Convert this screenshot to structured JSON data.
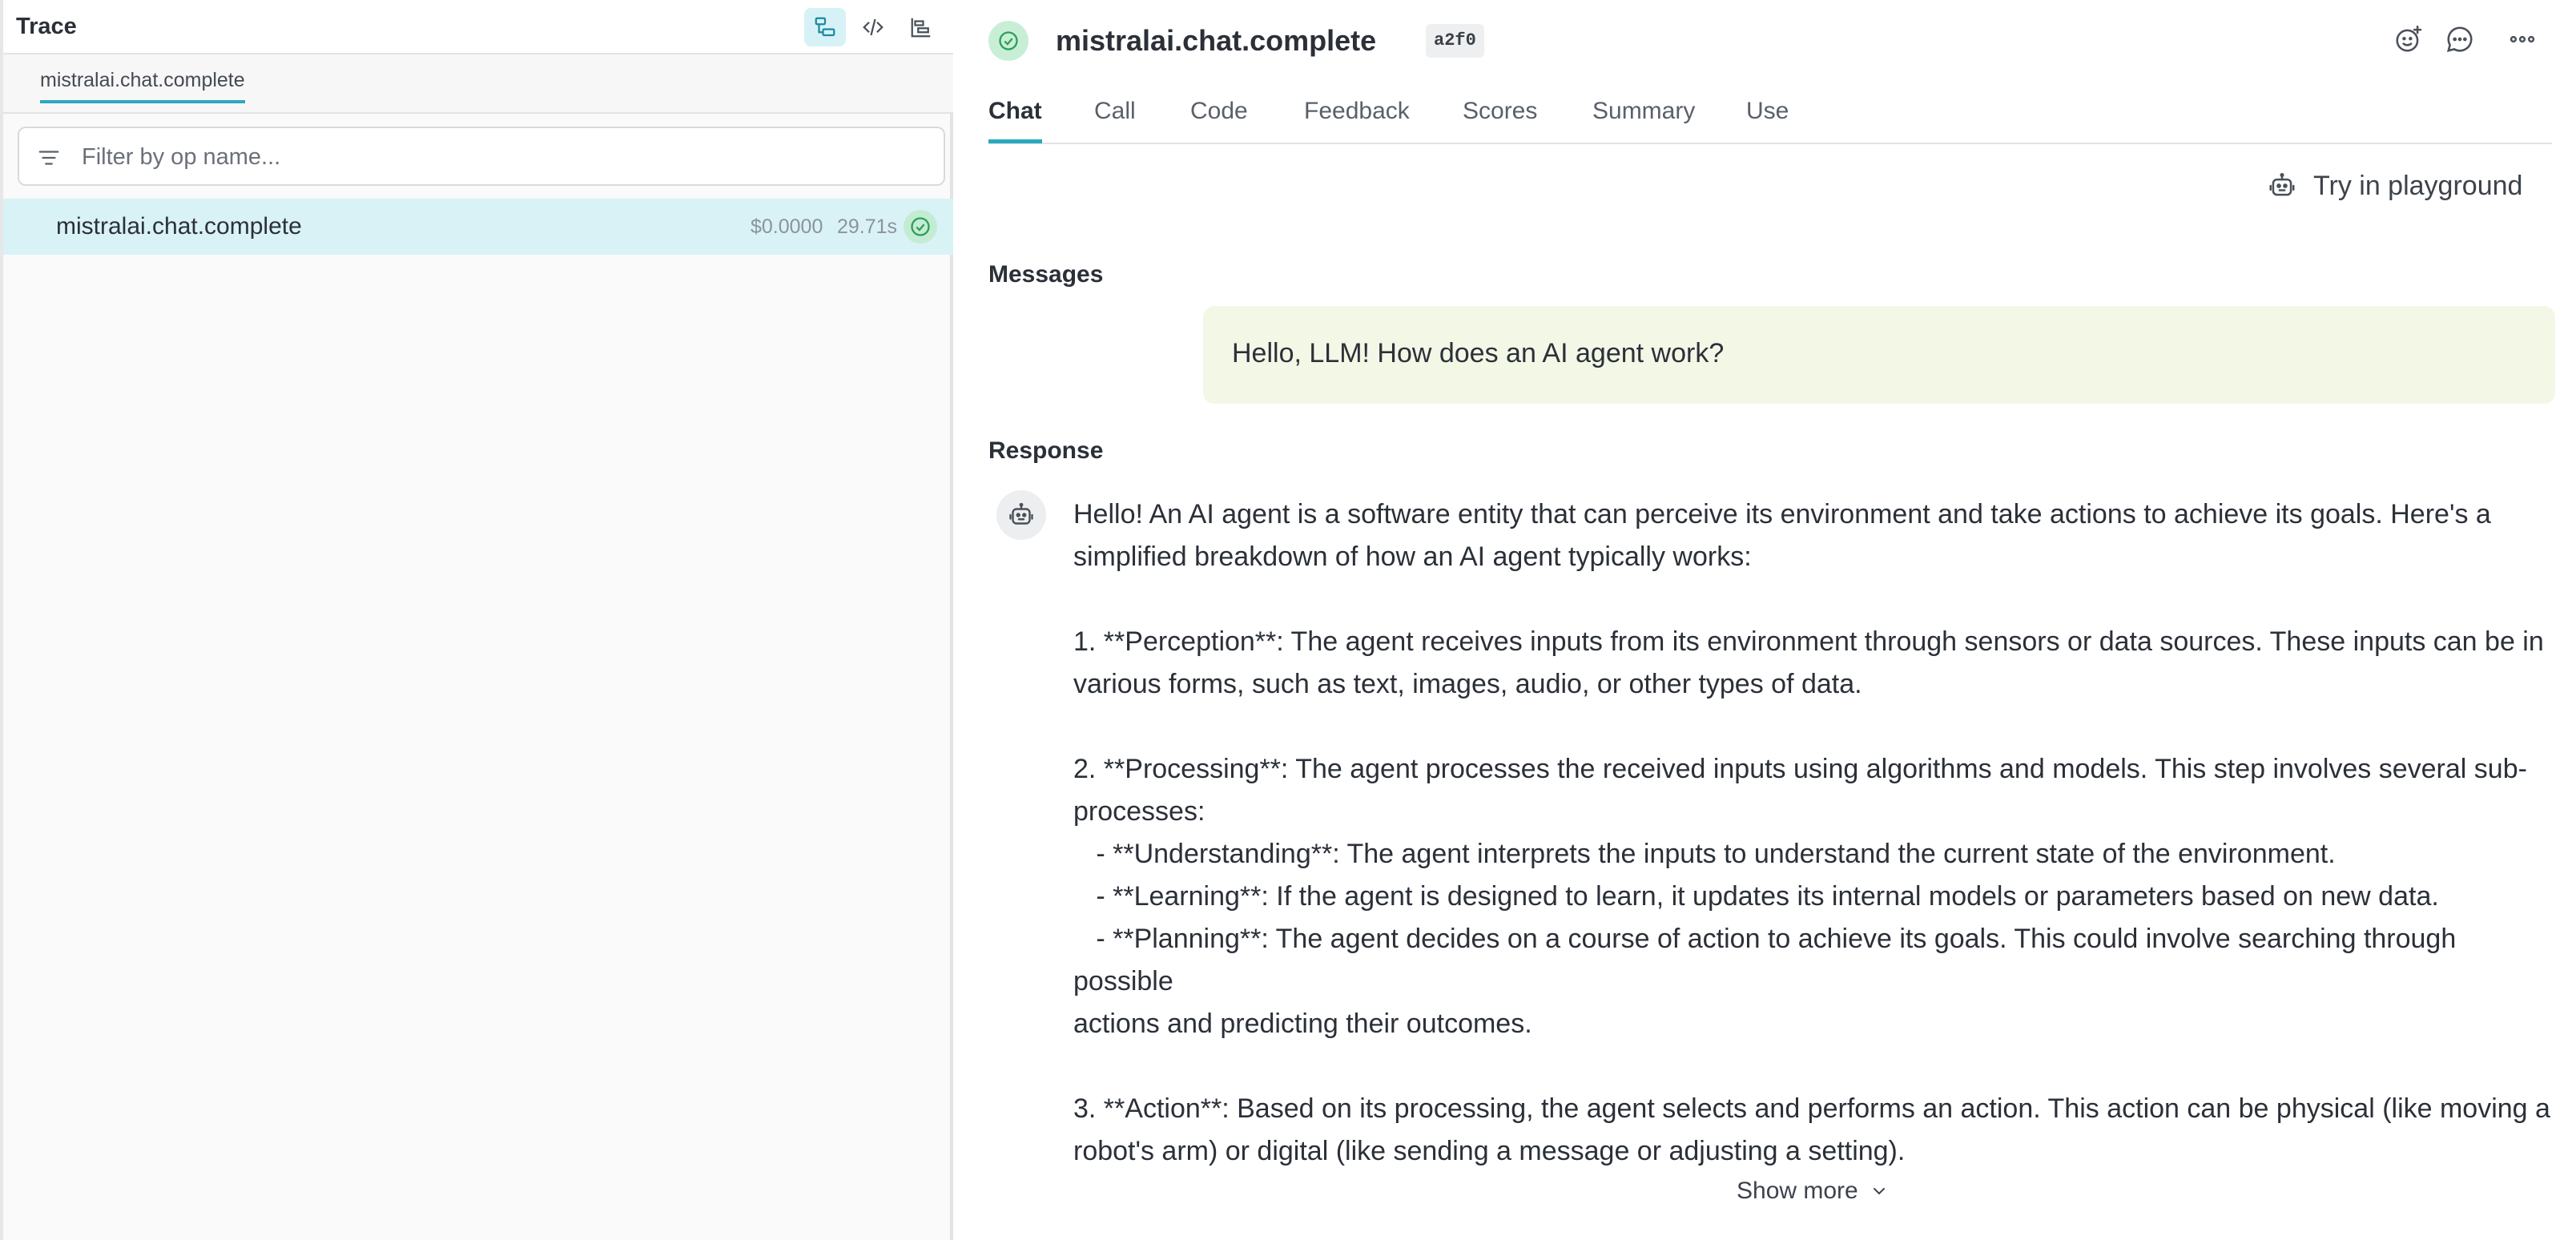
{
  "left_panel": {
    "title": "Trace",
    "tab": "mistralai.chat.complete",
    "filter": {
      "placeholder": "Filter by op name...",
      "value": ""
    },
    "trace_rows": [
      {
        "name": "mistralai.chat.complete",
        "cost": "$0.0000",
        "duration": "29.71s",
        "status": "success"
      }
    ]
  },
  "call": {
    "title": "mistralai.chat.complete",
    "id": "a2f0"
  },
  "tabs": [
    {
      "label": "Chat",
      "active": true
    },
    {
      "label": "Call"
    },
    {
      "label": "Code"
    },
    {
      "label": "Feedback"
    },
    {
      "label": "Scores"
    },
    {
      "label": "Summary"
    },
    {
      "label": "Use"
    }
  ],
  "playground_label": "Try in playground",
  "messages_label": "Messages",
  "user_message": "Hello, LLM! How does an AI agent work?",
  "response_label": "Response",
  "response_text": "Hello! An AI agent is a software entity that can perceive its environment and take actions to achieve its goals. Here's a\nsimplified breakdown of how an AI agent typically works:\n\n1. **Perception**: The agent receives inputs from its environment through sensors or data sources. These inputs can be in\nvarious forms, such as text, images, audio, or other types of data.\n\n2. **Processing**: The agent processes the received inputs using algorithms and models. This step involves several sub-\nprocesses:\n   - **Understanding**: The agent interprets the inputs to understand the current state of the environment.\n   - **Learning**: If the agent is designed to learn, it updates its internal models or parameters based on new data.\n   - **Planning**: The agent decides on a course of action to achieve its goals. This could involve searching through possible\nactions and predicting their outcomes.\n\n3. **Action**: Based on its processing, the agent selects and performs an action. This action can be physical (like moving a\nrobot's arm) or digital (like sending a message or adjusting a setting).",
  "show_more_label": "Show more",
  "colors": {
    "accent": "#2aa8bf",
    "success": "#2e9e5b",
    "selected_row": "#d9f2f6",
    "user_bubble": "#f3f7e6"
  }
}
